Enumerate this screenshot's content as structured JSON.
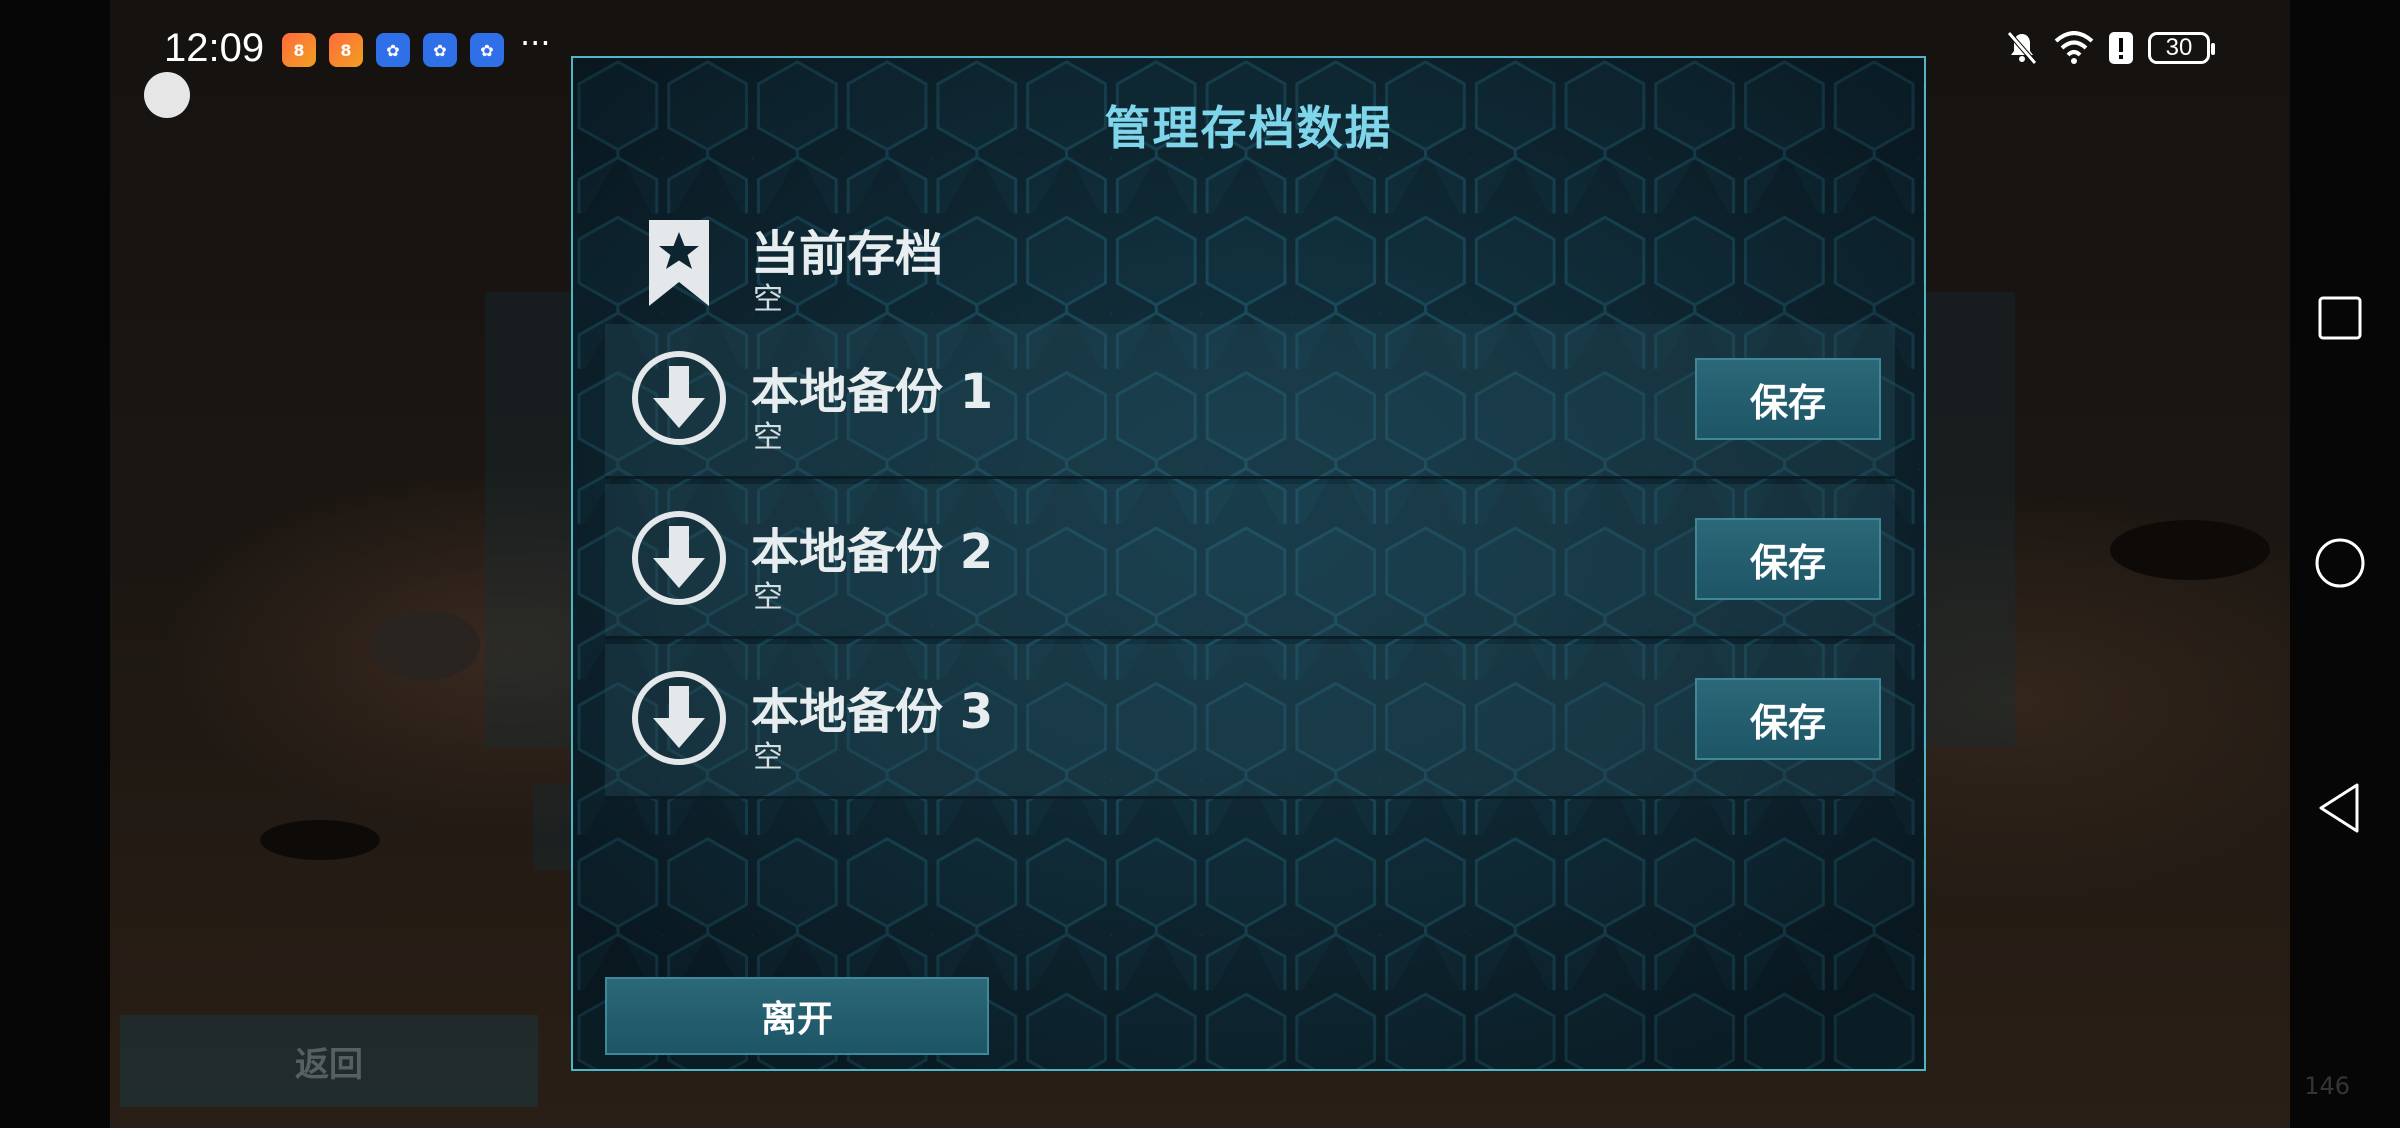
{
  "status_bar": {
    "time": "12:09",
    "notification_icons": [
      "app-orange-icon",
      "app-orange-icon",
      "baidu-icon",
      "baidu-icon",
      "baidu-icon"
    ],
    "more": "···",
    "battery": "30"
  },
  "background": {
    "back_label": "返回",
    "corner_number": "146"
  },
  "dialog": {
    "title": "管理存档数据",
    "current_save": {
      "label": "当前存档",
      "status": "空"
    },
    "backups": [
      {
        "label": "本地备份 1",
        "status": "空",
        "button": "保存"
      },
      {
        "label": "本地备份 2",
        "status": "空",
        "button": "保存"
      },
      {
        "label": "本地备份 3",
        "status": "空",
        "button": "保存"
      }
    ],
    "leave_label": "离开"
  },
  "colors": {
    "title": "#7fd6ea",
    "border": "#4fb6c8",
    "button": "#2b6878"
  }
}
